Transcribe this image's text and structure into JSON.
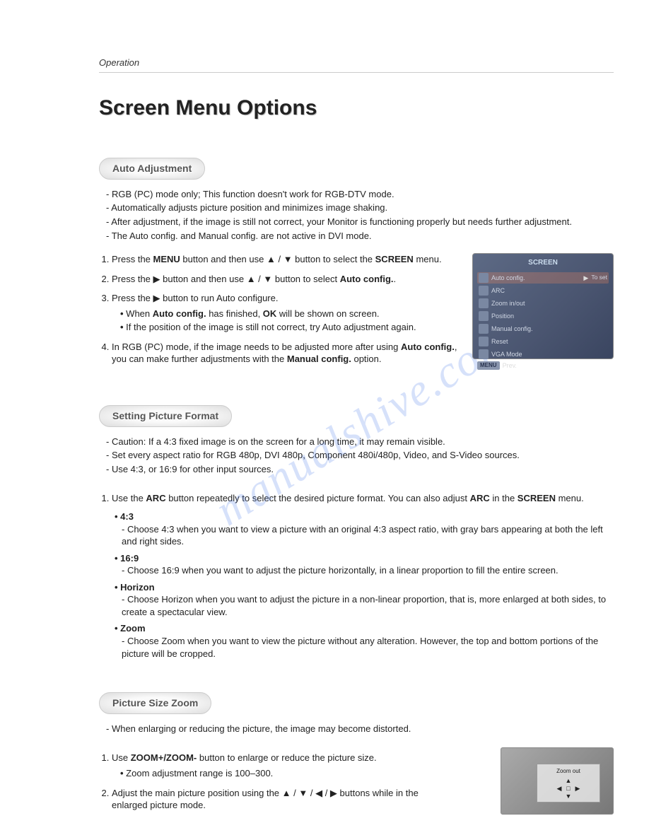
{
  "breadcrumb": "Operation",
  "title": "Screen Menu Options",
  "watermark": "manualshive.com",
  "icons": {
    "up": "▲",
    "down": "▼",
    "left": "◀",
    "right": "▶"
  },
  "sections": {
    "auto": {
      "heading": "Auto Adjustment",
      "notes": [
        "RGB (PC) mode only; This function doesn't work for RGB-DTV mode.",
        "Automatically adjusts picture position and minimizes image shaking.",
        "After adjustment, if the image is still not correct, your Monitor is functioning properly but needs further adjustment.",
        "The Auto config. and Manual config. are not active in DVI mode."
      ],
      "steps": {
        "s1_a": "Press the ",
        "s1_menu": "MENU",
        "s1_b": " button and then use ",
        "s1_c": " button to select the ",
        "s1_screen": "SCREEN",
        "s1_d": " menu.",
        "s2_a": "Press the ",
        "s2_b": " button and then use ",
        "s2_c": " button to select ",
        "s2_auto": "Auto config.",
        "s2_d": ".",
        "s3_a": "Press the ",
        "s3_b": " button to run Auto configure.",
        "s3_sub1_a": "When ",
        "s3_sub1_b": "Auto config.",
        "s3_sub1_c": " has finished, ",
        "s3_sub1_d": "OK",
        "s3_sub1_e": " will be shown on screen.",
        "s3_sub2": "If the position of the image is still not correct, try Auto adjustment again.",
        "s4_a": "In RGB (PC) mode, if the image needs to be adjusted more after using ",
        "s4_b": "Auto config.",
        "s4_c": ", you can make further adjustments with the ",
        "s4_d": "Manual config.",
        "s4_e": " option."
      },
      "menu_shot": {
        "header": "SCREEN",
        "items": [
          {
            "label": "Auto config.",
            "right": "To set",
            "selected": true
          },
          {
            "label": "ARC",
            "right": "",
            "selected": false
          },
          {
            "label": "Zoom in/out",
            "right": "",
            "selected": false
          },
          {
            "label": "Position",
            "right": "",
            "selected": false
          },
          {
            "label": "Manual config.",
            "right": "",
            "selected": false
          },
          {
            "label": "Reset",
            "right": "",
            "selected": false
          },
          {
            "label": "VGA Mode",
            "right": "",
            "selected": false
          }
        ],
        "footer_btn": "MENU",
        "footer_label": "Prev."
      }
    },
    "fmt": {
      "heading": "Setting Picture Format",
      "notes": [
        "Caution: If a 4:3 fixed image is on the screen for a long time, it may remain visible.",
        "Set every aspect ratio for RGB 480p, DVI 480p, Component 480i/480p, Video, and S-Video sources.",
        "Use 4:3, or 16:9 for other input sources."
      ],
      "step1_a": "Use the ",
      "step1_arc": "ARC",
      "step1_b": " button repeatedly to select the desired picture format. You can also adjust ",
      "step1_c": " in the ",
      "step1_screen": "SCREEN",
      "step1_d": " menu.",
      "options": [
        {
          "name": "4:3",
          "desc": "Choose 4:3 when you want to view a picture with an original 4:3 aspect ratio, with gray bars appearing at both the left and right sides."
        },
        {
          "name": "16:9",
          "desc": "Choose 16:9 when you want to adjust the picture horizontally, in a linear proportion to fill the entire screen."
        },
        {
          "name": "Horizon",
          "desc": "Choose Horizon when you want to adjust the picture in a non-linear proportion, that is, more enlarged at both sides, to create a spectacular view."
        },
        {
          "name": "Zoom",
          "desc": "Choose Zoom when you want to view the picture without any alteration. However, the top and bottom portions of the picture will be cropped."
        }
      ]
    },
    "zoom": {
      "heading": "Picture Size Zoom",
      "notes": [
        "When enlarging or reducing the picture, the image may become distorted."
      ],
      "step1_a": "Use ",
      "step1_b": "ZOOM+/ZOOM-",
      "step1_c": " button to enlarge or reduce the picture size.",
      "step1_sub": "Zoom adjustment range is 100–300.",
      "step2_a": "Adjust the main picture position using the ",
      "step2_b": " buttons while in the enlarged picture mode.",
      "overlay_label": "Zoom out"
    }
  }
}
